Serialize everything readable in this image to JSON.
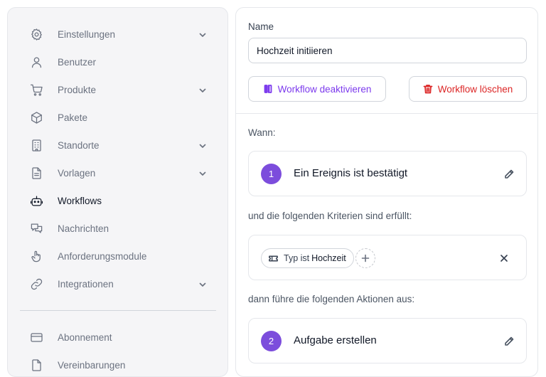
{
  "sidebar": {
    "items": [
      {
        "label": "Einstellungen",
        "icon": "gear-icon",
        "has_submenu": true
      },
      {
        "label": "Benutzer",
        "icon": "user-icon",
        "has_submenu": false
      },
      {
        "label": "Produkte",
        "icon": "cart-icon",
        "has_submenu": true
      },
      {
        "label": "Pakete",
        "icon": "box-icon",
        "has_submenu": false
      },
      {
        "label": "Standorte",
        "icon": "building-icon",
        "has_submenu": true
      },
      {
        "label": "Vorlagen",
        "icon": "document-icon",
        "has_submenu": true
      },
      {
        "label": "Workflows",
        "icon": "robot-icon",
        "has_submenu": false,
        "active": true
      },
      {
        "label": "Nachrichten",
        "icon": "chat-icon",
        "has_submenu": false
      },
      {
        "label": "Anforderungsmodule",
        "icon": "hand-pointer-icon",
        "has_submenu": false
      },
      {
        "label": "Integrationen",
        "icon": "link-icon",
        "has_submenu": true
      }
    ],
    "bottom_items": [
      {
        "label": "Abonnement",
        "icon": "credit-card-icon"
      },
      {
        "label": "Vereinbarungen",
        "icon": "document-icon"
      }
    ]
  },
  "form": {
    "name_label": "Name",
    "name_value": "Hochzeit initiieren",
    "deactivate_label": "Workflow deaktivieren",
    "delete_label": "Workflow löschen"
  },
  "workflow": {
    "when_label": "Wann:",
    "trigger": {
      "number": "1",
      "title": "Ein Ereignis ist bestätigt"
    },
    "criteria_label": "und die folgenden Kriterien sind erfüllt:",
    "criterion": {
      "prefix": "Typ ist",
      "value": "Hochzeit"
    },
    "actions_label": "dann führe die folgenden Aktionen aus:",
    "action": {
      "number": "2",
      "title": "Aufgabe erstellen"
    }
  },
  "colors": {
    "accent": "#7c4ddc",
    "danger": "#dc2626",
    "sidebar_bg": "#f5f5f7"
  }
}
